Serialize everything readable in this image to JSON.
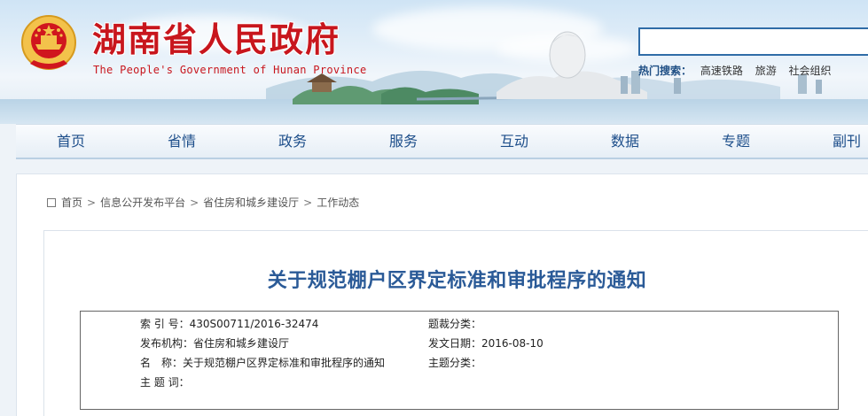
{
  "header": {
    "title": "湖南省人民政府",
    "subtitle": "The People's Government of Hunan Province",
    "hot_search": {
      "label": "热门搜索：",
      "links": [
        "高速铁路",
        "旅游",
        "社会组织"
      ]
    }
  },
  "nav": {
    "items": [
      "首页",
      "省情",
      "政务",
      "服务",
      "互动",
      "数据",
      "专题",
      "副刊"
    ]
  },
  "breadcrumb": {
    "items": [
      "首页",
      "信息公开发布平台",
      "省住房和城乡建设厅",
      "工作动态"
    ],
    "separator": ">"
  },
  "article": {
    "title": "关于规范棚户区界定标准和审批程序的通知",
    "meta": {
      "index_label": "索 引 号：",
      "index_value": "430S00711/2016-32474",
      "genre_label": "题裁分类：",
      "genre_value": "",
      "publisher_label": "发布机构：",
      "publisher_value": "省住房和城乡建设厅",
      "date_label": "发文日期：",
      "date_value": "2016-08-10",
      "name_label": "名　称：",
      "name_value": "关于规范棚户区界定标准和审批程序的通知",
      "topic_label": "主题分类：",
      "topic_value": "",
      "keywords_label": "主 题 词：",
      "keywords_value": ""
    }
  },
  "colors": {
    "brand_red": "#c8161d",
    "nav_blue": "#1d4e8a",
    "title_blue": "#2a5a97",
    "search_border": "#2f6ca7"
  }
}
